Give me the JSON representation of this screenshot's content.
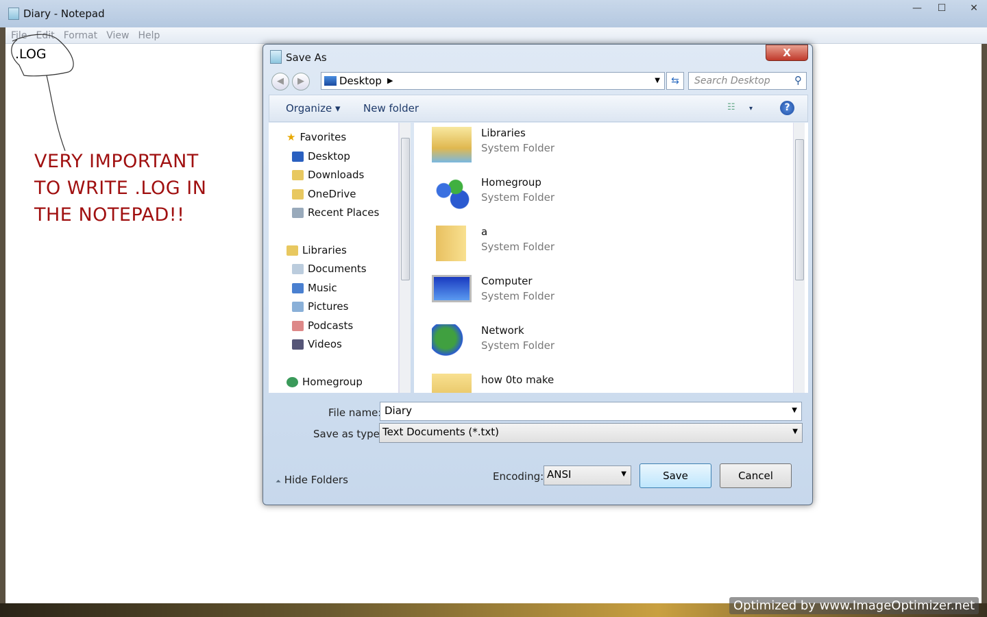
{
  "notepad": {
    "title": "Diary - Notepad",
    "menu": [
      "File",
      "Edit",
      "Format",
      "View",
      "Help"
    ],
    "content": ".LOG",
    "annotation": [
      "VERY IMPORTANT",
      "TO WRITE .LOG IN",
      "THE NOTEPAD!!"
    ],
    "window_buttons": {
      "minimize": "—",
      "maximize": "☐",
      "close": "✕"
    }
  },
  "dialog": {
    "title": "Save As",
    "close": "X",
    "address": "Desktop",
    "address_arrow": "▶",
    "search_placeholder": "Search Desktop",
    "toolbar": {
      "organize": "Organize ▾",
      "new_folder": "New folder",
      "view_toggle": "▾",
      "help": "?"
    },
    "nav": {
      "favorites": "Favorites",
      "fav_items": [
        "Desktop",
        "Downloads",
        "OneDrive",
        "Recent Places"
      ],
      "libraries": "Libraries",
      "lib_items": [
        "Documents",
        "Music",
        "Pictures",
        "Podcasts",
        "Videos"
      ],
      "homegroup": "Homegroup"
    },
    "files": [
      {
        "name": "Libraries",
        "type": "System Folder",
        "icon": "libraries-icon"
      },
      {
        "name": "Homegroup",
        "type": "System Folder",
        "icon": "homegroup-icon"
      },
      {
        "name": "a",
        "type": "System Folder",
        "icon": "user-folder-icon"
      },
      {
        "name": "Computer",
        "type": "System Folder",
        "icon": "computer-icon"
      },
      {
        "name": "Network",
        "type": "System Folder",
        "icon": "network-icon"
      },
      {
        "name": "how 0to make",
        "type": "",
        "icon": "folder-icon"
      }
    ],
    "file_name_label": "File name:",
    "file_name": "Diary",
    "save_type_label": "Save as type:",
    "save_type": "Text Documents (*.txt)",
    "hide_folders": "Hide Folders",
    "encoding_label": "Encoding:",
    "encoding": "ANSI",
    "save": "Save",
    "cancel": "Cancel"
  },
  "watermark": "Optimized by www.ImageOptimizer.net"
}
